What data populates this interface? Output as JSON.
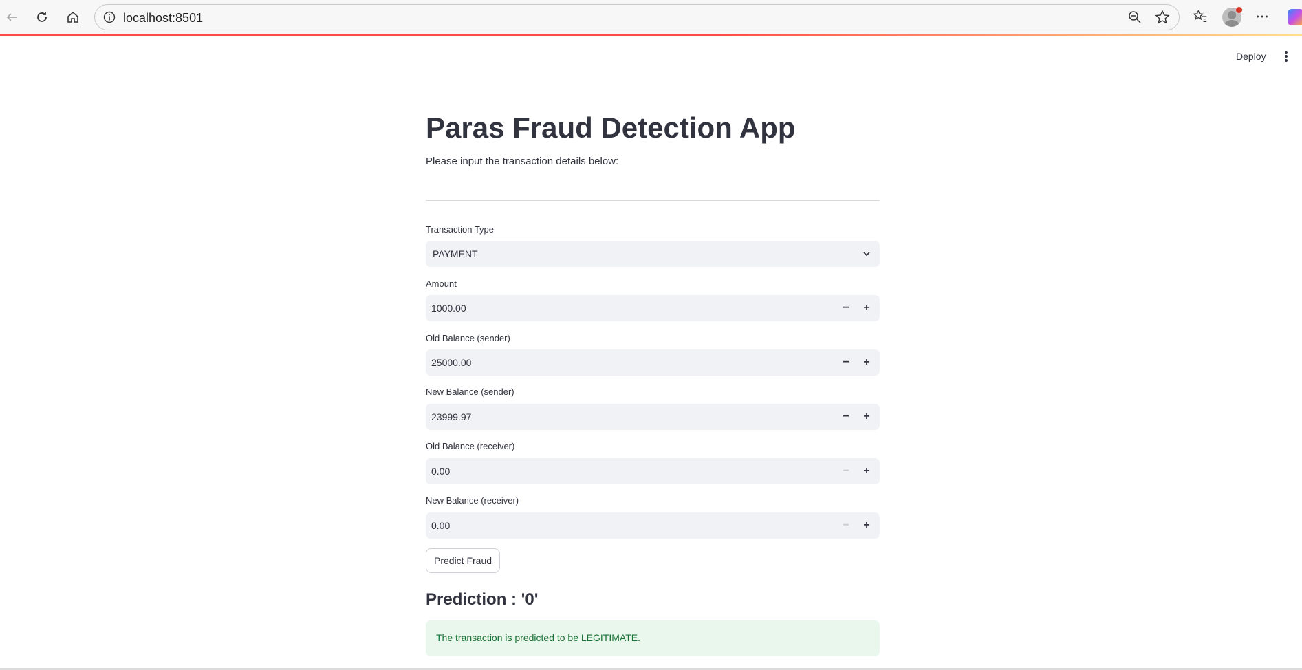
{
  "browser": {
    "url": "localhost:8501"
  },
  "header": {
    "deploy_label": "Deploy"
  },
  "main": {
    "title": "Paras Fraud Detection App",
    "subtitle": "Please input the transaction details below:",
    "transaction_type": {
      "label": "Transaction Type",
      "value": "PAYMENT"
    },
    "fields": [
      {
        "label": "Amount",
        "value": "1000.00",
        "minus_enabled": true
      },
      {
        "label": "Old Balance (sender)",
        "value": "25000.00",
        "minus_enabled": true
      },
      {
        "label": "New Balance (sender)",
        "value": "23999.97",
        "minus_enabled": true
      },
      {
        "label": "Old Balance (receiver)",
        "value": "0.00",
        "minus_enabled": false
      },
      {
        "label": "New Balance (receiver)",
        "value": "0.00",
        "minus_enabled": false
      }
    ],
    "stepper": {
      "minus": "−",
      "plus": "+"
    },
    "predict_button": "Predict Fraud",
    "prediction_heading": "Prediction : '0'",
    "result_message": "The transaction is predicted to be LEGITIMATE."
  },
  "colors": {
    "accent": "#ff4b4b",
    "input_bg": "#f0f2f6",
    "success_bg": "#e9f7ec",
    "success_text": "#177233"
  },
  "icons": [
    "back-arrow-icon",
    "reload-icon",
    "home-icon",
    "info-icon",
    "zoom-out-icon",
    "star-icon",
    "favorites-icon",
    "profile-avatar-icon",
    "more-icon",
    "copilot-icon",
    "chevron-down-icon",
    "kebab-menu-icon"
  ]
}
